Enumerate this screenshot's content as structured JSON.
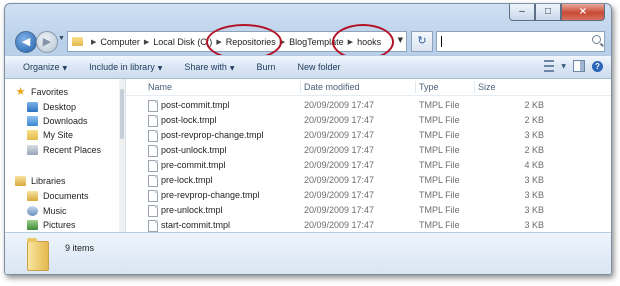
{
  "window": {
    "caption": {
      "minimize": "–",
      "maximize": "□",
      "close": "×"
    }
  },
  "nav": {
    "back_icon": "back-arrow-icon",
    "forward_icon": "forward-arrow-icon",
    "breadcrumb": [
      "Computer",
      "Local Disk (C:)",
      "Repositories",
      "BlogTemplate",
      "hooks"
    ],
    "search_placeholder": ""
  },
  "toolbar": {
    "items": [
      "Organize",
      "Include in library",
      "Share with",
      "Burn",
      "New folder"
    ]
  },
  "sidebar": {
    "favorites_label": "Favorites",
    "favorites": [
      "Desktop",
      "Downloads",
      "My Site",
      "Recent Places"
    ],
    "libraries_label": "Libraries",
    "libraries": [
      "Documents",
      "Music",
      "Pictures"
    ]
  },
  "columns": {
    "name": "Name",
    "date": "Date modified",
    "type": "Type",
    "size": "Size"
  },
  "files": [
    {
      "name": "post-commit.tmpl",
      "date": "20/09/2009 17:47",
      "type": "TMPL File",
      "size": "2 KB"
    },
    {
      "name": "post-lock.tmpl",
      "date": "20/09/2009 17:47",
      "type": "TMPL File",
      "size": "2 KB"
    },
    {
      "name": "post-revprop-change.tmpl",
      "date": "20/09/2009 17:47",
      "type": "TMPL File",
      "size": "3 KB"
    },
    {
      "name": "post-unlock.tmpl",
      "date": "20/09/2009 17:47",
      "type": "TMPL File",
      "size": "2 KB"
    },
    {
      "name": "pre-commit.tmpl",
      "date": "20/09/2009 17:47",
      "type": "TMPL File",
      "size": "4 KB"
    },
    {
      "name": "pre-lock.tmpl",
      "date": "20/09/2009 17:47",
      "type": "TMPL File",
      "size": "3 KB"
    },
    {
      "name": "pre-revprop-change.tmpl",
      "date": "20/09/2009 17:47",
      "type": "TMPL File",
      "size": "3 KB"
    },
    {
      "name": "pre-unlock.tmpl",
      "date": "20/09/2009 17:47",
      "type": "TMPL File",
      "size": "3 KB"
    },
    {
      "name": "start-commit.tmpl",
      "date": "20/09/2009 17:47",
      "type": "TMPL File",
      "size": "3 KB"
    }
  ],
  "status": {
    "item_count": "9 items"
  },
  "colors": {
    "highlight_ellipse": "#b31226",
    "toolbar_text": "#1e395b"
  }
}
